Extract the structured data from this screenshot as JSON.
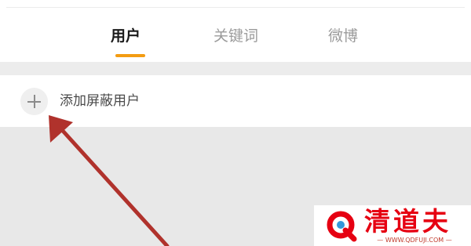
{
  "tabs": [
    {
      "label": "用户",
      "active": true
    },
    {
      "label": "关键词",
      "active": false
    },
    {
      "label": "微博",
      "active": false
    }
  ],
  "add_row": {
    "icon": "plus-icon",
    "label": "添加屏蔽用户"
  },
  "watermark": {
    "brand": "清道夫",
    "url": "— WWW.QDFUJI.COM —"
  },
  "colors": {
    "accent": "#f39c12",
    "annotation_arrow": "#b0322c",
    "watermark_red": "#e60012"
  }
}
